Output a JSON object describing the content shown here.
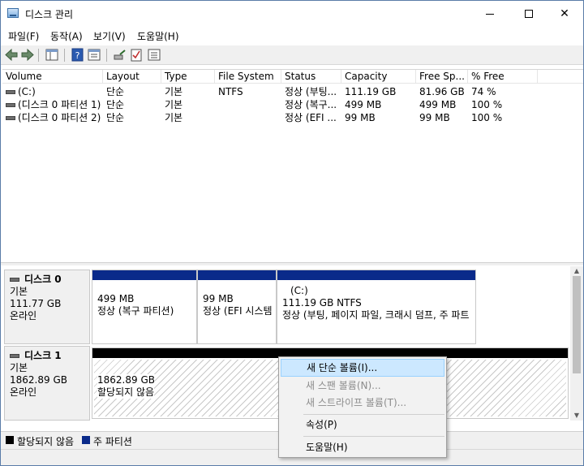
{
  "window": {
    "title": "디스크 관리"
  },
  "menu": [
    "파일(F)",
    "동작(A)",
    "보기(V)",
    "도움말(H)"
  ],
  "toolbar": {
    "icons": [
      "back-arrow-icon",
      "forward-arrow-icon",
      "console-tree-icon",
      "help-icon",
      "properties-icon",
      "connect-icon",
      "check-icon",
      "list-view-icon"
    ]
  },
  "table": {
    "columns": [
      "Volume",
      "Layout",
      "Type",
      "File System",
      "Status",
      "Capacity",
      "Free Sp...",
      "% Free"
    ],
    "rows": [
      [
        "(C:)",
        "단순",
        "기본",
        "NTFS",
        "정상 (부팅...",
        "111.19 GB",
        "81.96 GB",
        "74 %"
      ],
      [
        "(디스크 0 파티션 1)",
        "단순",
        "기본",
        "",
        "정상 (복구...",
        "499 MB",
        "499 MB",
        "100 %"
      ],
      [
        "(디스크 0 파티션 2)",
        "단순",
        "기본",
        "",
        "정상 (EFI ...",
        "99 MB",
        "99 MB",
        "100 %"
      ]
    ]
  },
  "disks": [
    {
      "name": "디스크 0",
      "type": "기본",
      "size": "111.77 GB",
      "state": "온라인",
      "partitions": [
        {
          "title": "",
          "size": "499 MB",
          "status": "정상 (복구 파티션)"
        },
        {
          "title": "",
          "size": "99 MB",
          "status": "정상 (EFI 시스템"
        },
        {
          "title": "(C:)",
          "size": "111.19 GB NTFS",
          "status": "정상 (부팅, 페이지 파일, 크래시 덤프, 주 파트"
        }
      ]
    },
    {
      "name": "디스크 1",
      "type": "기본",
      "size": "1862.89 GB",
      "state": "온라인",
      "partitions": [
        {
          "title": "",
          "size": "1862.89 GB",
          "status": "할당되지 않음"
        }
      ]
    }
  ],
  "legend": [
    {
      "label": "할당되지 않음",
      "color": "#000000"
    },
    {
      "label": "주 파티션",
      "color": "#0a2a8a"
    }
  ],
  "context_menu": {
    "items": [
      {
        "label": "새 단순 볼륨(I)...",
        "enabled": true,
        "highlighted": true
      },
      {
        "label": "새 스팬 볼륨(N)...",
        "enabled": false
      },
      {
        "label": "새 스트라이프 볼륨(T)...",
        "enabled": false
      },
      {
        "label": "속성(P)",
        "enabled": true
      },
      {
        "label": "도움말(H)",
        "enabled": true
      }
    ]
  }
}
